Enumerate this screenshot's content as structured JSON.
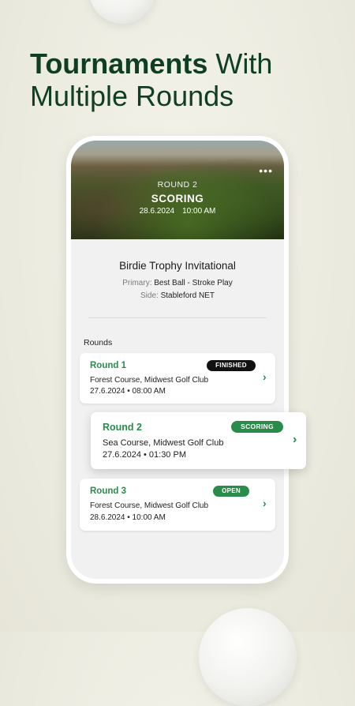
{
  "headline": {
    "line1_bold": "Tournaments",
    "line1_light": "With",
    "line2": "Multiple Rounds"
  },
  "hero": {
    "menu_icon": "more-dots-icon",
    "round_label": "ROUND 2",
    "status": "SCORING",
    "date": "28.6.2024",
    "time": "10:00 AM"
  },
  "tournament": {
    "name": "Birdie Trophy Invitational",
    "primary_label": "Primary:",
    "primary_value": "Best Ball - Stroke Play",
    "side_label": "Side:",
    "side_value": "Stableford NET"
  },
  "rounds": {
    "section_label": "Rounds",
    "items": [
      {
        "title": "Round 1",
        "badge": "FINISHED",
        "course": "Forest Course, Midwest Golf Club",
        "datetime": "27.6.2024 • 08:00 AM"
      },
      {
        "title": "Round 2",
        "badge": "SCORING",
        "course": "Sea Course, Midwest Golf Club",
        "datetime": "27.6.2024 • 01:30 PM"
      },
      {
        "title": "Round 3",
        "badge": "OPEN",
        "course": "Forest Course, Midwest Golf Club",
        "datetime": "28.6.2024 • 10:00 AM"
      }
    ]
  },
  "colors": {
    "brand_dark_green": "#0f3e22",
    "accent_green": "#2a8c4a",
    "finished_badge": "#111111"
  }
}
